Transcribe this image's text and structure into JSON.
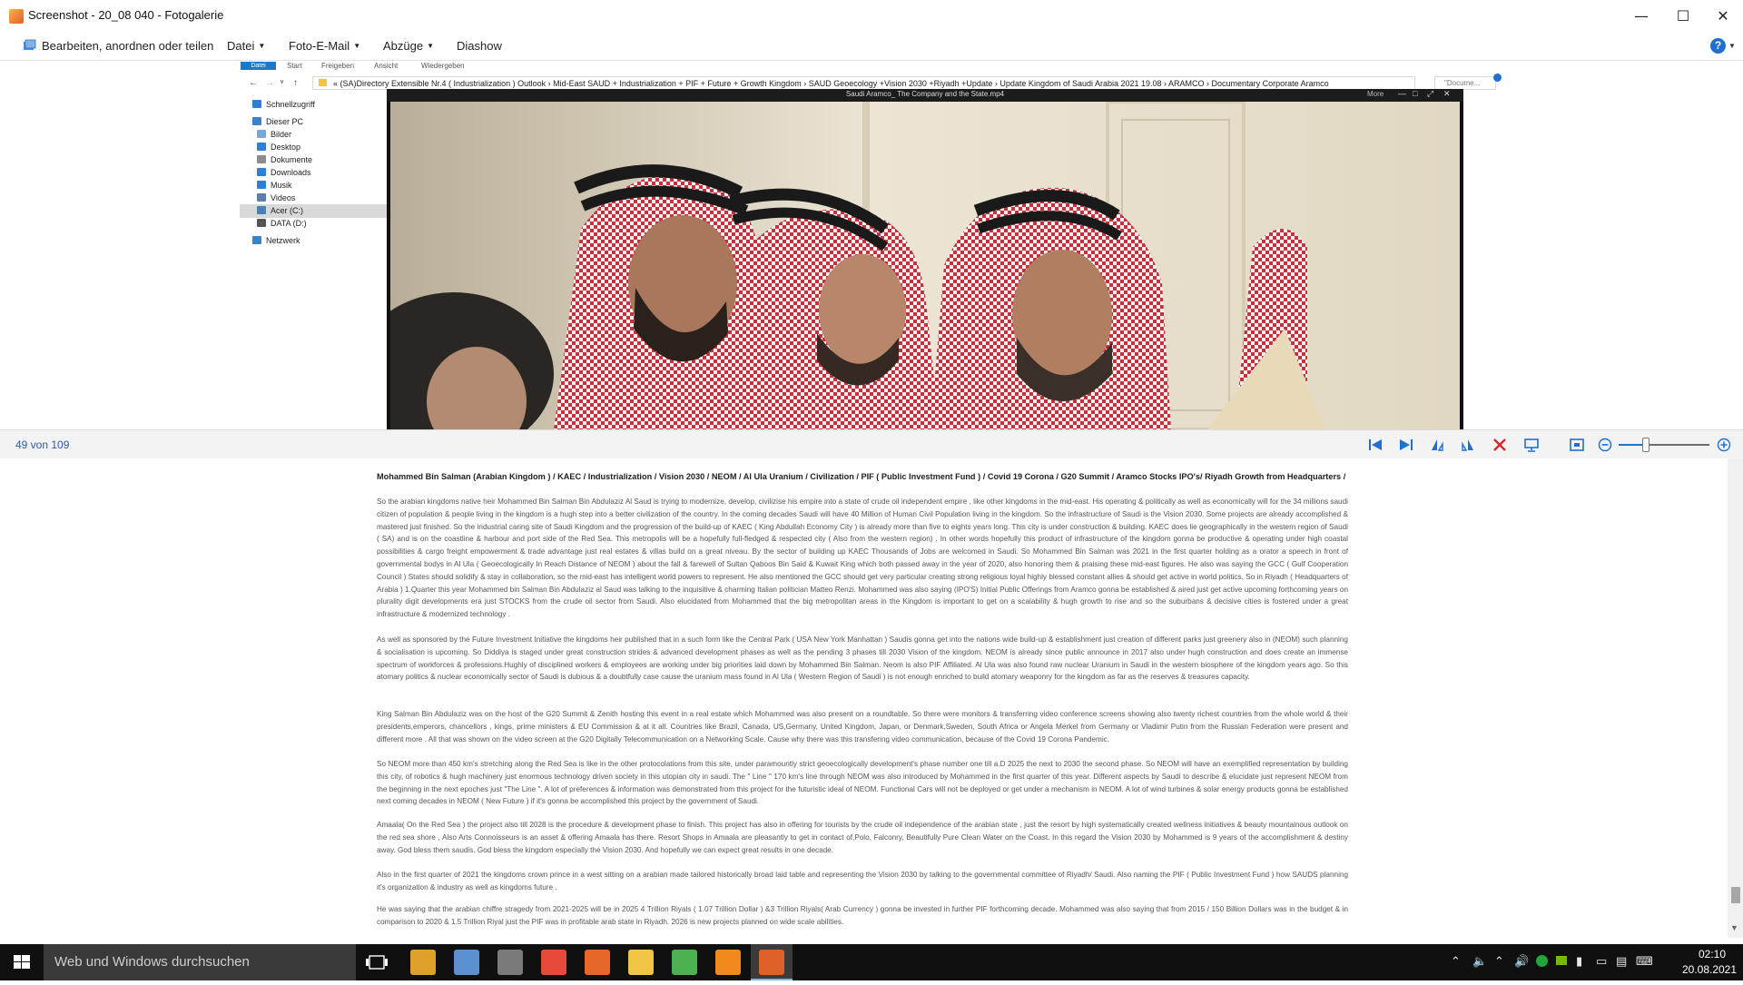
{
  "window": {
    "title": "Screenshot - 20_08 040 - Fotogalerie",
    "minimize_glyph": "—",
    "maximize_glyph": "☐",
    "close_glyph": "✕"
  },
  "menu": {
    "edit_label": "Bearbeiten, anordnen oder teilen",
    "file_label": "Datei",
    "email_label": "Foto-E-Mail",
    "prints_label": "Abzüge",
    "slideshow_label": "Diashow",
    "help_glyph": "?"
  },
  "explorer": {
    "tabs": [
      "Datei",
      "Start",
      "Freigeben",
      "Ansicht",
      "Wiedergeben"
    ],
    "address": "«  (SA)Directory Extensible Nr.4 ( Industrialization )  Outlook   ›   Mid-East SAUD + Industrialization + PIF + Future + Growth Kingdom   ›   SAUD Geoecology +Vision 2030 +Riyadh +Update   ›   Update Kingdom of Saudi Arabia 2021 19.08   ›   ARAMCO   ›   Documentary Corporate Aramco",
    "search_placeholder": "\"Docume...",
    "nav": [
      {
        "label": "Schnellzugriff",
        "color": "#2f7fd6"
      },
      {
        "label": "Dieser PC",
        "color": "#3a83c8"
      },
      {
        "label": "Bilder",
        "color": "#7aa7d8"
      },
      {
        "label": "Desktop",
        "color": "#2f7fd6"
      },
      {
        "label": "Dokumente",
        "color": "#8c8c8c"
      },
      {
        "label": "Downloads",
        "color": "#2f7fd6"
      },
      {
        "label": "Musik",
        "color": "#2f7fd6"
      },
      {
        "label": "Videos",
        "color": "#5b7fae"
      },
      {
        "label": "Acer (C:)",
        "color": "#4a7fb8"
      },
      {
        "label": "DATA (D:)",
        "color": "#555555"
      },
      {
        "label": "Netzwerk",
        "color": "#3a83c8"
      }
    ]
  },
  "player": {
    "title": "Saudi Aramco_ The Company and the State.mp4",
    "more_label": "More",
    "controls": [
      "—",
      "□",
      "⤢",
      "✕"
    ]
  },
  "status": {
    "position_text": "49 von 109",
    "zoom_level": 0.3
  },
  "document": {
    "heading": "Mohammed Bin Salman (Arabian Kingdom ) / KAEC / Industrialization /  Vision 2030  / NEOM / Al Ula Uranium / Civilization  / PIF ( Public Investment Fund ) / Covid 19 Corona / G20 Summit / Aramco Stocks IPO's/ Riyadh Growth from Headquarters /",
    "paragraphs": [
      "So the arabian kingdoms native heir  Mohammed Bin Salman Bin Abdulaziz Al Saud is trying to modernize, develop, civilizise his empire into a state of crude oil independent empire , like other kingdoms in the mid-east. His operating & politically as well as economically will for the 34 millions  saudi citizen of population & people living in the kingdom is a hugh step into  a better civilization of the country. In the coming decades  Saudi will have 40  Million of Human Civil Population living in the kingdom. So the infrastructure of Saudi is the Vision 2030. Some projects are already accomplished & mastered just finished. So the industrial caring site of Saudi Kingdom and the progression of the build-up of KAEC ( King Abdullah Economy City ) is already more than five to eights years long. This city is under construction & building. KAEC does lie geographically in the western region of Saudi ( SA) and is on the coastline & harbour and port side of the Red Sea. This metropolis will be a hopefully full-fledged  & respected  city ( Also from the western region) . In other words hopefully this product of infrastructure of the kingdom gonna be productive & operating under high coastal possibilities & cargo  freight empowerment & trade advantage just real estates & villas build on a great niveau.  By the sector of building up KAEC Thousands of Jobs are welcomed in Saudi. So Mohammed Bin Salman was 2021 in the first quarter holding as a orator a speech in front of governmental bodys in  Al Ula ( Geoecologically In Reach Distance of NEOM ) about the fall & farewell  of Sultan Qaboos Bin Said & Kuwait King which both passed away in the year of 2020, also honoring them & praising these mid-east figures. He also was saying the GCC ( Gulf Cooperation Council )  States should solidify & stay in collaboration, so the mid-east has intelligent world powers to represent. He also mentioned the GCC should get very particular creating strong religious loyal highly blessed constant allies & should get  active in world politics. So in Riyadh  ( Headquarters of Arabia ) 1.Quarter this year Mohammed bin Salman Bin Abdulaziz al Saud was talking to the inquisitive & charming  Italian politician Matteo Renzi. Mohammed was also saying (IPO'S) Initial Public Offerings from Aramco gonna be established & aired just get active upcoming forthcoming years on plurality  digit developments era just STOCKS from the crude oil sector from Saudi. Also elucidated from Mohammed that the big metropolitan areas in the Kingdom is important  to get on a scalability & hugh growth to rise and so the suburbans  & decisive cities is fostered under a great infrastructure & modernized technology .",
      "As well as sponsored by the  Future Investment Initiative the kingdoms heir published that in a such form like the Central Park ( USA New York Manhattan ) Saudis gonna get into the nations wide build-up & establishment just creation of different parks just greenery also in (NEOM) such planning & socialisation is upcoming. So Diddiya is staged under great construction strides & advanced development phases as well as the pending 3 phases till 2030  Vision of the kingdom. NEOM is already since public announce in 2017 also under hugh construction and does create an immense spectrum of workforces & professions.Hughly of disciplined  workers & employees are working under big  priorities laid down by Mohammed Bin Salman. Neom is also  PIF Affiliated. Al Ula was also found raw nuclear Uranium in Saudi in the western biosphere of the kingdom years ago. So this atomary politics & nuclear economically sector of Saudi is dubious & a doubtfully case cause the uranium mass  found in Al Ula ( Western Region of Saudi ) is not enough enriched to build atomary weaponry for the kingdom as far as the reserves & treasures capacity.",
      "King Salman Bin Abdulaziz was on the host of the G20 Summit  & Zenith hosting this event in a real estate which Mohammed was also present on a roundtable. So there were monitors & transferring video conference screens showing also twenty richest countries from the whole world & their presidents,emperors, chancellors , kings, prime ministers & EU Commission & at it all. Countries like Brazil, Canada, US,Germany, United Kingdom, Japan, or Denmark,Sweden,  South Africa  or Angela Merkel from Germany  or Vladimir Putin from the Russian Federation were present and different more . All that was shown on the video screen at the G20 Digitally  Telecommunication  on a Networking Scale. Cause why there was  this transfering video communication, because of the Covid 19 Corona Pandemic.",
      "So NEOM more than 450 km's stretching along the Red Sea is like in the other protocolations from this site, under paramountly strict geoecologically development's phase number one till a.D 2025 the next to 2030 the second phase. So NEOM will have an exemplified representation by building this city, of robotics & hugh machinery just enormous technology driven society in this utopian city in saudi. The \" Line \" 170 km's line through NEOM was also introduced by Mohammed in the first quarter of this year. Different aspects by Saudi to describe & elucidate just represent NEOM from the beginning in the next epoches just \"The  Line \". A lot of preferences & information  was demonstrated from this project for the futuristic ideal of NEOM. Functional Cars will not be deployed or get under a mechanism in NEOM. A lot of wind turbines & solar energy products gonna be established next coming decades in NEOM ( New Future ) if it's gonna be accomplished this project by the government of Saudi.",
      "Amaala( On the Red Sea ) the project also till 2028 is the procedure & development phase to finish. This project has also in offering for tourists by the crude oil independence of the arabian state , just the resort  by high systematically created wellness initiatives  & beauty mountainous outlook on the red sea shore , Also Arts Connoisseurs is an asset & offering Amaala has there. Resort Shops in Amaala are pleasantly to get in contact of,Polo, Falconry, Beautifully Pure Clean Water on the Coast. In this regard the Vision 2030 by Mohammed is 9 years of the accomplishment  & destiny away. God bless them saudis. God bless the kingdom especially the Vision 2030. And hopefully we can expect great results in one decade.",
      " Also in the first quarter of 2021 the kingdoms crown prince in a west sitting on a arabian made tailored historically broad laid table and representing the Vision 2030 by talking to the governmental committee of Riyadh/ Saudi. Also naming the PIF ( Public Investment Fund ) how SAUDS planning it's organization & industry as well as kingdoms future .",
      "He was  saying that the  arabian chiffre stragedy  from 2021-2025  will be in 2025 4 Trillion Riyals ( 1.07 Trillion Dollar ) &3 Trillion Riyals( Arab Currency ) gonna be invested in further PIF forthcoming decade. Mohammed was also saying that from 2015  / 150 Billion Dollars was in the budget & in comparison to 2020 & 1.5 Trillion Riyal just the PIF was in profitable arab state in Riyadh.   2026 is new projects planned on wide scale abilities."
    ]
  },
  "taskbar": {
    "search_placeholder": "Web und Windows durchsuchen",
    "time": "02:10",
    "date": "20.08.2021",
    "apps": [
      {
        "name": "chrome-app-icon",
        "color": "#e0a12a"
      },
      {
        "name": "pdf-app-icon",
        "color": "#5a8fd0"
      },
      {
        "name": "media-app-icon",
        "color": "#7a7a7a"
      },
      {
        "name": "chrome-alt-app-icon",
        "color": "#e84a3a"
      },
      {
        "name": "office-app-icon",
        "color": "#e7662a"
      },
      {
        "name": "folder-app-icon",
        "color": "#f2c544"
      },
      {
        "name": "picasa-app-icon",
        "color": "#4caf50"
      },
      {
        "name": "vlc-app-icon",
        "color": "#f08a1c"
      },
      {
        "name": "gallery-app-icon",
        "color": "#e0602b"
      }
    ]
  }
}
